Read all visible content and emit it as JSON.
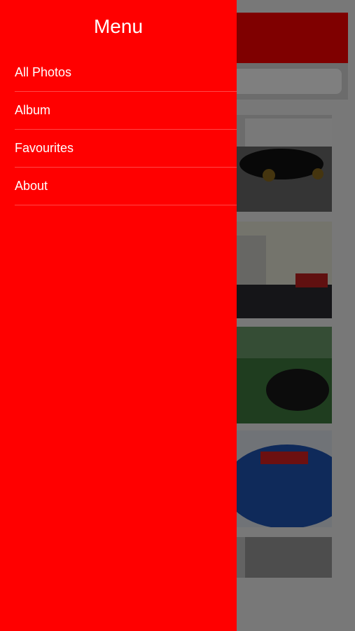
{
  "colors": {
    "drawer_background": "#ff0000",
    "drawer_text": "#ffffff",
    "overlay": "rgba(0,0,0,0.5)"
  },
  "drawer": {
    "title": "Menu",
    "items": [
      {
        "label": "All Photos"
      },
      {
        "label": "Album"
      },
      {
        "label": "Favourites"
      },
      {
        "label": "About"
      }
    ]
  },
  "background_app": {
    "photos": [
      {
        "subject": "black car near building"
      },
      {
        "subject": "red car by industrial tanks"
      },
      {
        "subject": "black car with open hood on grass"
      },
      {
        "subject": "blue car rear close-up"
      },
      {
        "subject": "garage interior"
      }
    ]
  }
}
